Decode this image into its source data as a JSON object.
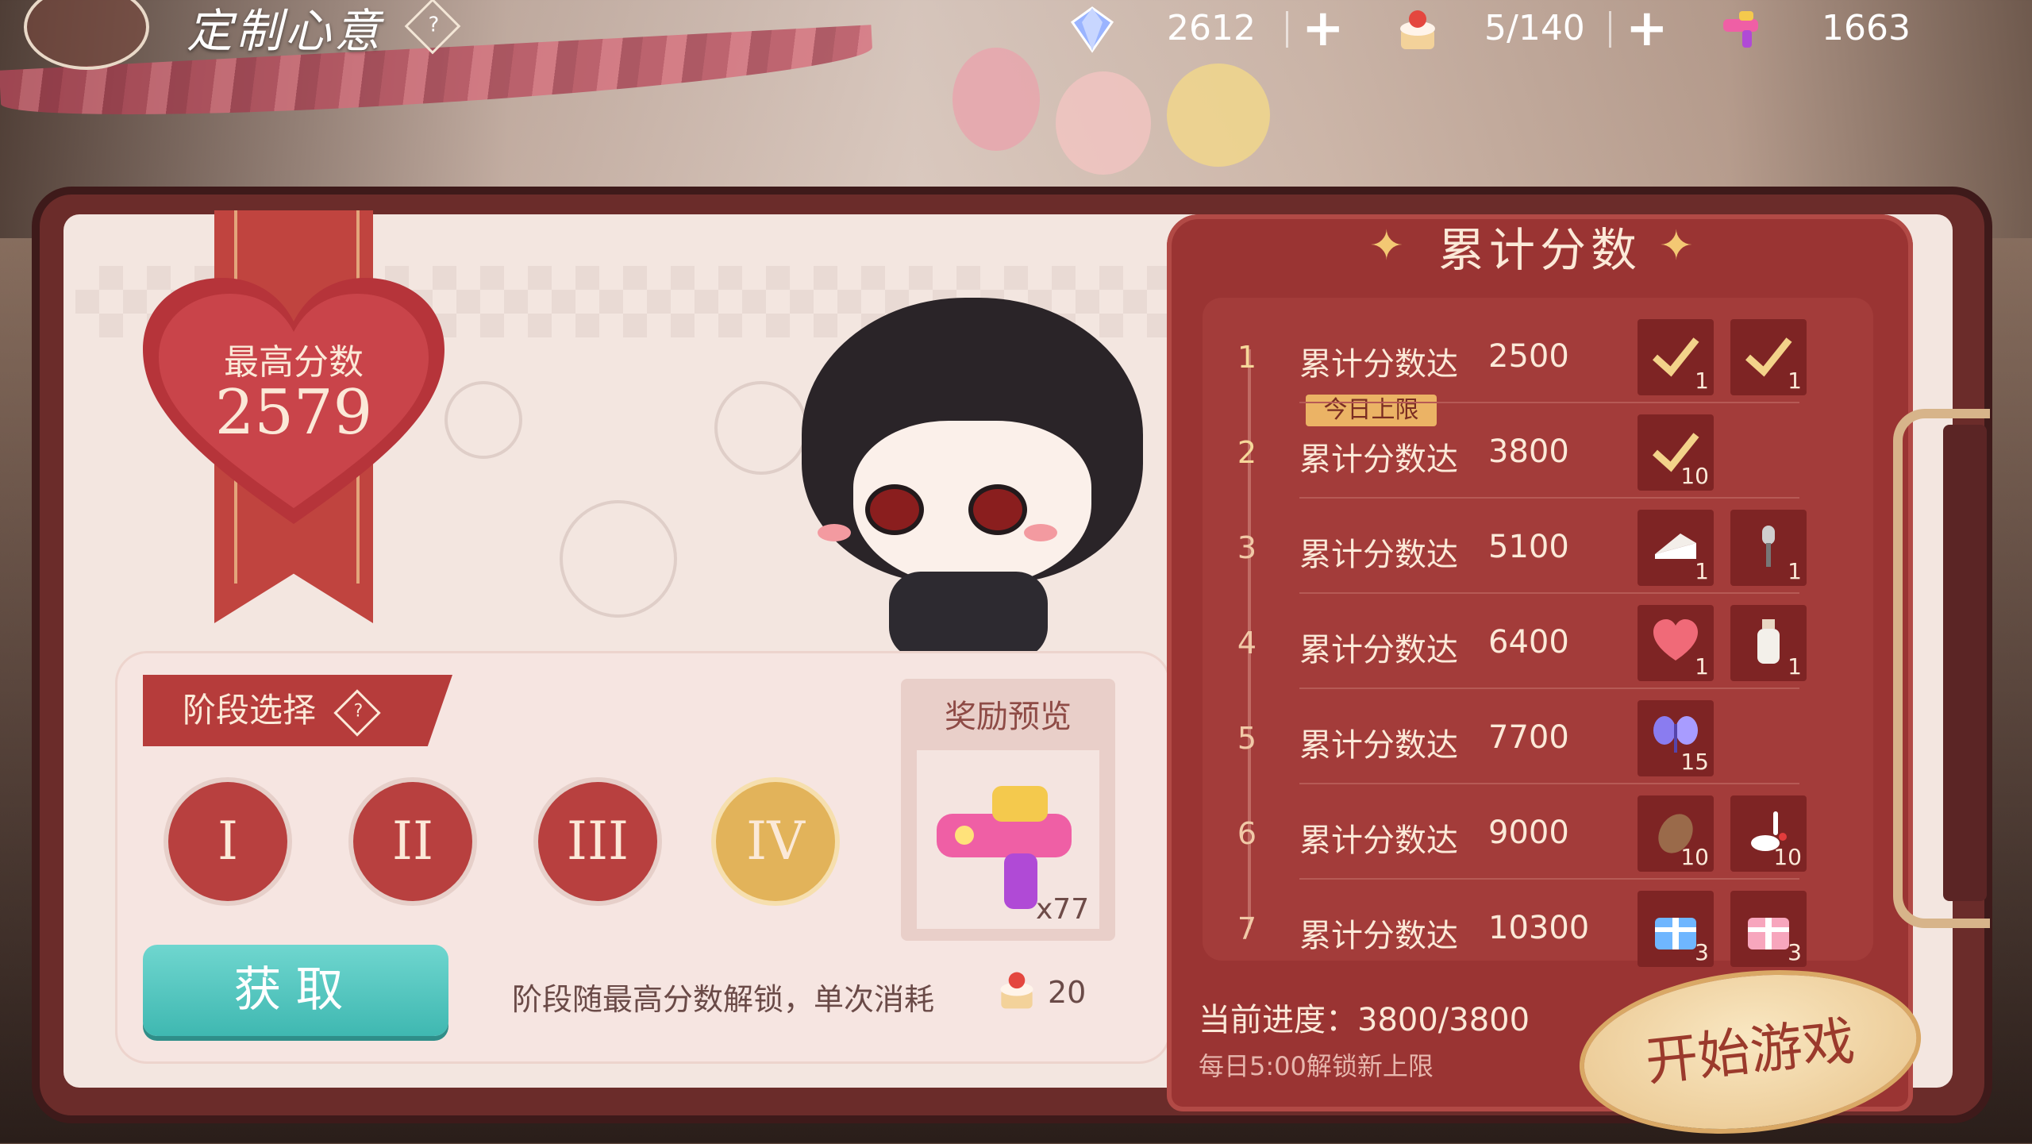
{
  "header": {
    "title": "定制心意",
    "help_icon_text": "?",
    "resources": [
      {
        "name": "diamond",
        "icon": "diamond-icon",
        "value": "2612",
        "addable": true,
        "color": "#8aa6ff"
      },
      {
        "name": "cake",
        "icon": "cake-icon",
        "value": "5/140",
        "addable": true,
        "color": "#e4473f"
      },
      {
        "name": "water-gun",
        "icon": "water-gun-icon",
        "value": "1663",
        "addable": false,
        "color": "#ef5fa5"
      }
    ],
    "plus_label": "+"
  },
  "best_score": {
    "label": "最高分数",
    "value": "2579"
  },
  "stage": {
    "title": "阶段选择",
    "help_icon_text": "?",
    "options": [
      {
        "label": "I",
        "active": false
      },
      {
        "label": "II",
        "active": false
      },
      {
        "label": "III",
        "active": false
      },
      {
        "label": "IV",
        "active": true
      }
    ],
    "obtain_label": "获取",
    "note": "阶段随最高分数解锁，单次消耗",
    "cost": "20"
  },
  "preview": {
    "title": "奖励预览",
    "count": "x77",
    "icon": "water-gun-icon"
  },
  "cumulative": {
    "title": "累计分数",
    "daily_limit_tag": "今日上限",
    "rows": [
      {
        "num": "1",
        "label": "累计分数达",
        "value": "2500",
        "completed": true,
        "rewards": [
          {
            "icon": "check-icon",
            "count": "1"
          },
          {
            "icon": "check-icon",
            "count": "1"
          }
        ]
      },
      {
        "num": "2",
        "label": "累计分数达",
        "value": "3800",
        "completed": true,
        "rewards": [
          {
            "icon": "check-icon",
            "count": "10"
          }
        ]
      },
      {
        "num": "3",
        "label": "累计分数达",
        "value": "5100",
        "completed": false,
        "rewards": [
          {
            "icon": "cake-slice-icon",
            "count": "1"
          },
          {
            "icon": "microphone-icon",
            "count": "1"
          }
        ]
      },
      {
        "num": "4",
        "label": "累计分数达",
        "value": "6400",
        "completed": false,
        "rewards": [
          {
            "icon": "heart-icon",
            "count": "1"
          },
          {
            "icon": "bottle-icon",
            "count": "1"
          }
        ]
      },
      {
        "num": "5",
        "label": "累计分数达",
        "value": "7700",
        "completed": false,
        "rewards": [
          {
            "icon": "butterfly-icon",
            "count": "15"
          }
        ]
      },
      {
        "num": "6",
        "label": "累计分数达",
        "value": "9000",
        "completed": false,
        "rewards": [
          {
            "icon": "pinecone-icon",
            "count": "10"
          },
          {
            "icon": "rabbit-icon",
            "count": "10"
          }
        ]
      },
      {
        "num": "7",
        "label": "累计分数达",
        "value": "10300",
        "completed": false,
        "rewards": [
          {
            "icon": "blue-gift-icon",
            "count": "3"
          },
          {
            "icon": "pink-gift-icon",
            "count": "3"
          }
        ]
      }
    ],
    "progress_label": "当前进度：",
    "progress_value": "3800/3800",
    "daily_note": "每日5:00解锁新上限",
    "start_label": "开始游戏"
  }
}
